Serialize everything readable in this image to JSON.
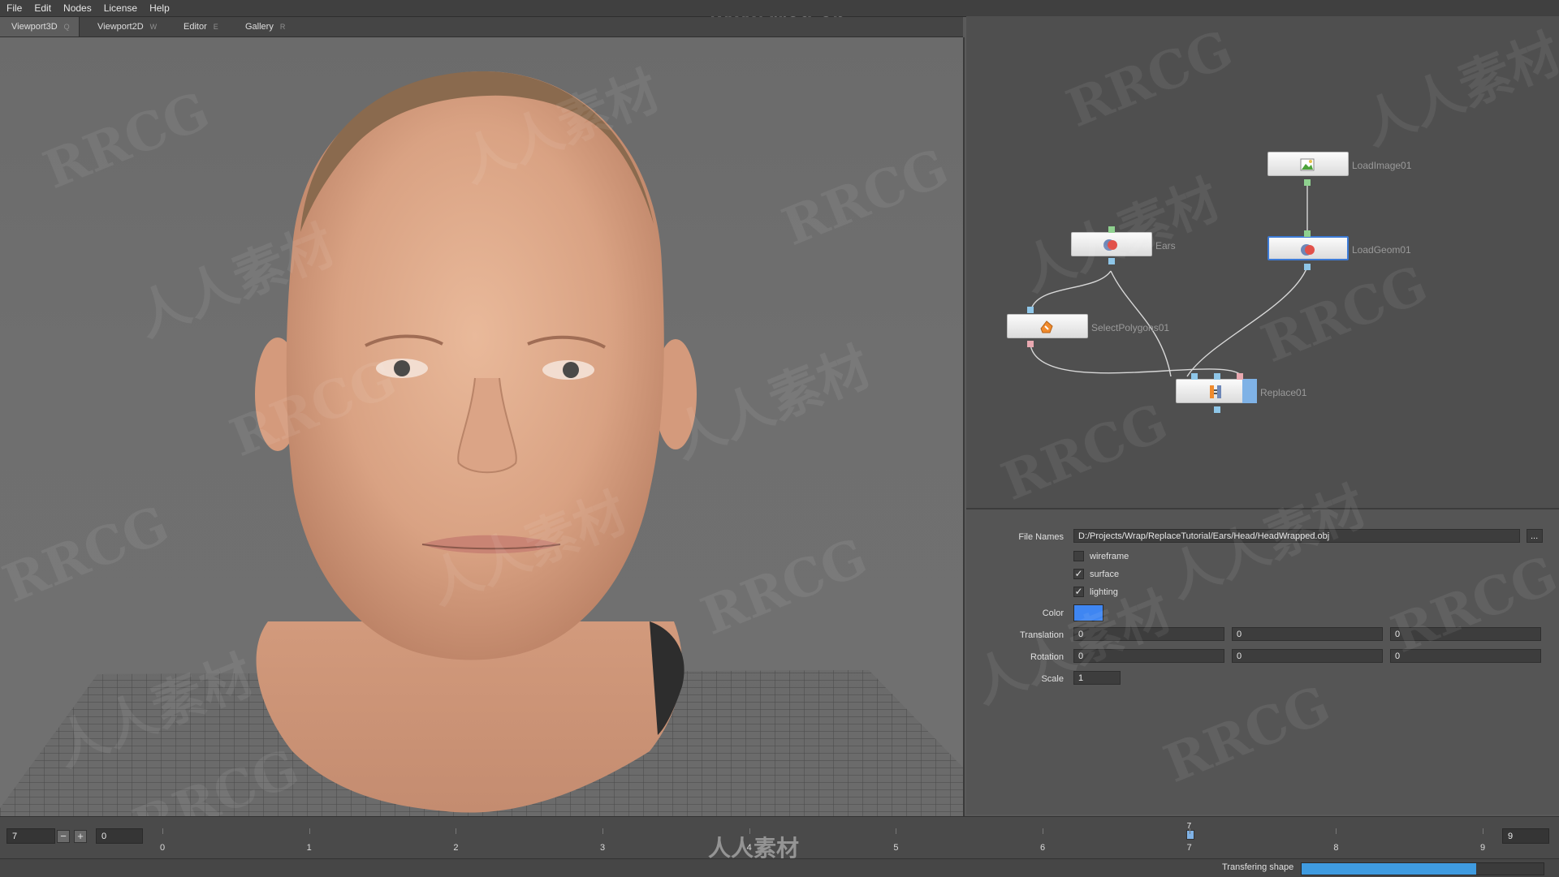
{
  "menu": [
    "File",
    "Edit",
    "Nodes",
    "License",
    "Help"
  ],
  "watermark_url": "www.rrcg.cn",
  "watermark_bottom": "人人素材",
  "tabs": [
    {
      "label": "Viewport3D",
      "key": "Q"
    },
    {
      "label": "Viewport2D",
      "key": "W"
    },
    {
      "label": "Editor",
      "key": "E"
    },
    {
      "label": "Gallery",
      "key": "R"
    }
  ],
  "nodes": {
    "load_image": "LoadImage01",
    "ears": "Ears",
    "load_geom": "LoadGeom01",
    "select_polygons": "SelectPolygons01",
    "replace": "Replace01"
  },
  "properties": {
    "file_names_label": "File Names",
    "file_names_value": "D:/Projects/Wrap/ReplaceTutorial/Ears/Head/HeadWrapped.obj",
    "browse_label": "...",
    "wireframe_label": "wireframe",
    "wireframe_checked": false,
    "surface_label": "surface",
    "surface_checked": true,
    "lighting_label": "lighting",
    "lighting_checked": true,
    "color_label": "Color",
    "color_value": "#3f86f2",
    "translation_label": "Translation",
    "translation": [
      "0",
      "0",
      "0"
    ],
    "rotation_label": "Rotation",
    "rotation": [
      "0",
      "0",
      "0"
    ],
    "scale_label": "Scale",
    "scale": "1"
  },
  "timeline": {
    "current_frame": "7",
    "minus": "−",
    "plus": "+",
    "start_frame": "0",
    "end_frame": "9",
    "marker_label": "7",
    "ticks": [
      "0",
      "1",
      "2",
      "3",
      "4",
      "5",
      "6",
      "7",
      "8",
      "9"
    ]
  },
  "status": {
    "text": "Transfering shape",
    "progress": 0.72
  },
  "colors": {
    "accent": "#3d7bd6",
    "progress": "#3f9be0"
  }
}
